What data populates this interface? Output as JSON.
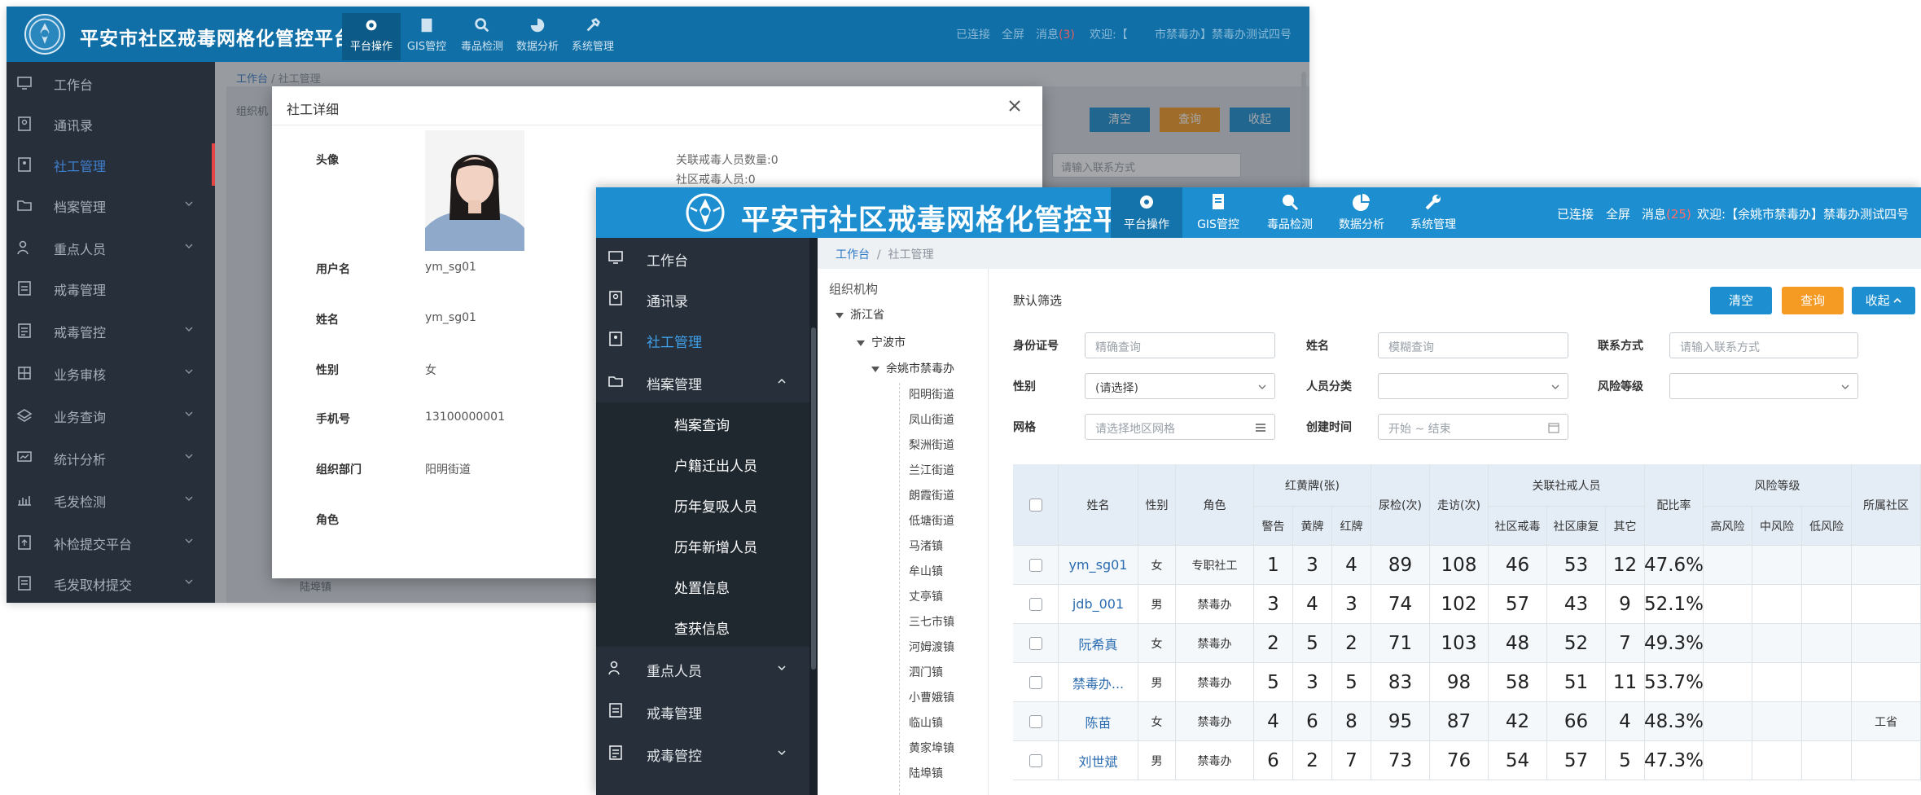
{
  "app": {
    "title": "平安市社区戒毒网格化管控平台",
    "nav": [
      "平台操作",
      "GIS管控",
      "毒品检测",
      "数据分析",
      "系统管理"
    ],
    "status_connected": "已连接",
    "status_fullscreen": "全屏",
    "status_messages": "消息",
    "status_message_count": "(25)",
    "status_welcome": "欢迎:【余姚市禁毒办】禁毒办测试四号",
    "colors": {
      "topbar": "#1d8fd0",
      "sidebar": "#27303a",
      "accent_blue": "#1d8fd0",
      "accent_orange": "#f59a23",
      "active_red": "#e64545"
    }
  },
  "back": {
    "status_welcome": "欢迎:【",
    "status_user": "市禁毒办】禁毒办测试四号",
    "status_message_count": "(3)",
    "sidebar": [
      "工作台",
      "通讯录",
      "社工管理",
      "档案管理",
      "重点人员",
      "戒毒管理",
      "戒毒管控",
      "业务审核",
      "业务查询",
      "统计分析",
      "毛发检测",
      "补检提交平台",
      "毛发取材提交"
    ],
    "breadcrumb": [
      "工作台",
      "社工管理"
    ],
    "tree_peek": "组织机",
    "buttons": [
      "清空",
      "查询",
      "收起"
    ],
    "input_placeholder": "请输入联系方式",
    "bottom_text": "陆埠镇"
  },
  "modal": {
    "title": "社工详细",
    "fields": [
      {
        "label": "头像",
        "value": ""
      },
      {
        "label": "用户名",
        "value": "ym_sg01"
      },
      {
        "label": "姓名",
        "value": "ym_sg01"
      },
      {
        "label": "性别",
        "value": "女"
      },
      {
        "label": "手机号",
        "value": "13100000001"
      },
      {
        "label": "组织部门",
        "value": "阳明街道"
      },
      {
        "label": "角色",
        "value": ""
      }
    ],
    "stats": [
      "关联戒毒人员数量:0",
      "社区戒毒人员:0"
    ]
  },
  "front": {
    "sidebar_top": [
      "工作台",
      "通讯录",
      "社工管理",
      "档案管理"
    ],
    "sidebar_sub": [
      "档案查询",
      "户籍迁出人员",
      "历年复吸人员",
      "历年新增人员",
      "处置信息",
      "查获信息"
    ],
    "sidebar_bottom": [
      "重点人员",
      "戒毒管理",
      "戒毒管控"
    ],
    "breadcrumb": [
      "工作台",
      "社工管理"
    ],
    "tree": {
      "title": "组织机构",
      "l1": "浙江省",
      "l2": "宁波市",
      "l3": "余姚市禁毒办",
      "leaves": [
        "阳明街道",
        "凤山街道",
        "梨洲街道",
        "兰江街道",
        "朗霞街道",
        "低塘街道",
        "马渚镇",
        "牟山镇",
        "丈亭镇",
        "三七市镇",
        "河姆渡镇",
        "泗门镇",
        "小曹娥镇",
        "临山镇",
        "黄家埠镇",
        "陆埠镇"
      ]
    },
    "filters": {
      "section_title": "默认筛选",
      "buttons": {
        "clear": "清空",
        "query": "查询",
        "collapse": "收起"
      },
      "id_label": "身份证号",
      "id_placeholder": "精确查询",
      "name_label": "姓名",
      "name_placeholder": "模糊查询",
      "contact_label": "联系方式",
      "contact_placeholder": "请输入联系方式",
      "gender_label": "性别",
      "gender_value": "(请选择)",
      "category_label": "人员分类",
      "category_value": "",
      "risk_label": "风险等级",
      "risk_value": "",
      "grid_label": "网格",
      "grid_placeholder": "请选择地区网格",
      "created_label": "创建时间",
      "created_placeholder": "开始 ~ 结束"
    },
    "table": {
      "headers": {
        "name": "姓名",
        "gender": "性别",
        "role": "角色",
        "cards_group": "红黄牌(张)",
        "warn": "警告",
        "yellow": "黄牌",
        "red": "红牌",
        "urine": "尿检(次)",
        "visit": "走访(次)",
        "related_group": "关联社戒人员",
        "community": "社区戒毒",
        "rehab": "社区康复",
        "other": "其它",
        "match_rate": "配比率",
        "risk_group": "风险等级",
        "high": "高风险",
        "mid": "中风险",
        "low": "低风险",
        "community_col": "所属社区"
      },
      "rows": [
        {
          "name": "ym_sg01",
          "gender": "女",
          "role": "专职社工",
          "warn": "1",
          "yellow": "3",
          "red": "4",
          "urine": "89",
          "visit": "108",
          "community": "46",
          "rehab": "53",
          "other": "12",
          "rate": "47.6%",
          "comm": ""
        },
        {
          "name": "jdb_001",
          "gender": "男",
          "role": "禁毒办",
          "warn": "3",
          "yellow": "4",
          "red": "3",
          "urine": "74",
          "visit": "102",
          "community": "57",
          "rehab": "43",
          "other": "9",
          "rate": "52.1%",
          "comm": ""
        },
        {
          "name": "阮希真",
          "gender": "女",
          "role": "禁毒办",
          "warn": "2",
          "yellow": "5",
          "red": "2",
          "urine": "71",
          "visit": "103",
          "community": "48",
          "rehab": "52",
          "other": "7",
          "rate": "49.3%",
          "comm": ""
        },
        {
          "name": "禁毒办...",
          "gender": "男",
          "role": "禁毒办",
          "warn": "5",
          "yellow": "3",
          "red": "5",
          "urine": "83",
          "visit": "98",
          "community": "58",
          "rehab": "51",
          "other": "11",
          "rate": "53.7%",
          "comm": ""
        },
        {
          "name": "陈苗",
          "gender": "女",
          "role": "禁毒办",
          "warn": "4",
          "yellow": "6",
          "red": "8",
          "urine": "95",
          "visit": "87",
          "community": "42",
          "rehab": "66",
          "other": "4",
          "rate": "48.3%",
          "comm": "工省"
        },
        {
          "name": "刘世斌",
          "gender": "男",
          "role": "禁毒办",
          "warn": "6",
          "yellow": "2",
          "red": "7",
          "urine": "73",
          "visit": "76",
          "community": "54",
          "rehab": "57",
          "other": "5",
          "rate": "47.3%",
          "comm": ""
        }
      ]
    }
  }
}
